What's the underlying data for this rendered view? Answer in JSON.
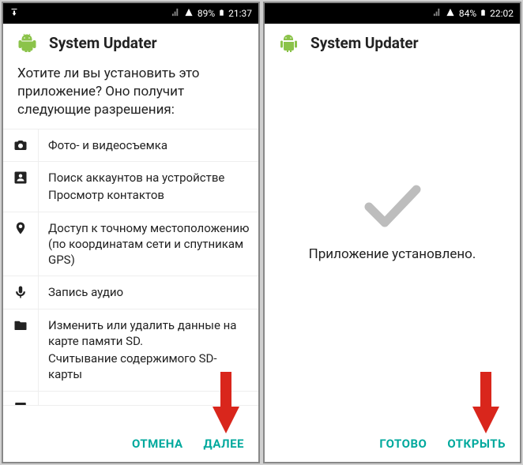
{
  "left": {
    "status": {
      "battery": "89%",
      "time": "21:37"
    },
    "title": "System Updater",
    "prompt": "Хотите ли вы установить это приложение? Оно получит следующие разрешения:",
    "perms": [
      {
        "icon": "camera",
        "lines": [
          "Фото- и видеосъемка"
        ]
      },
      {
        "icon": "contacts",
        "lines": [
          "Поиск аккаунтов на устройстве",
          "Просмотр контактов"
        ]
      },
      {
        "icon": "location",
        "lines": [
          "Доступ к точному местоположению (по координатам сети и спутникам GPS)"
        ]
      },
      {
        "icon": "mic",
        "lines": [
          "Запись аудио"
        ]
      },
      {
        "icon": "storage",
        "lines": [
          "Изменить или удалить данные на карте памяти SD.",
          "Считывание содержимого SD-карты"
        ]
      }
    ],
    "cancel": "ОТМЕНА",
    "next": "ДАЛЕЕ"
  },
  "right": {
    "status": {
      "battery": "84%",
      "time": "22:02"
    },
    "title": "System Updater",
    "installed": "Приложение установлено.",
    "done": "ГОТОВО",
    "open": "ОТКРЫТЬ"
  },
  "colors": {
    "accent": "#00a99d",
    "arrow": "#d9261c"
  }
}
